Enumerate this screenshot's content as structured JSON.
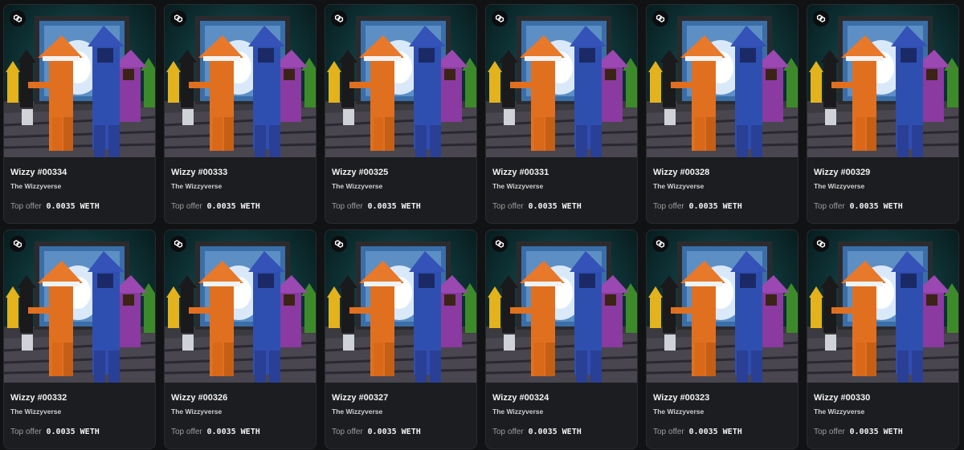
{
  "offer_label": "Top offer",
  "chain_icon": "polygon-chain-icon",
  "colors": {
    "background": "#111214",
    "card": "#1c1d20",
    "text": "#f2f2f2",
    "muted": "#9c9c9c"
  },
  "items": [
    {
      "name": "Wizzy #00334",
      "collection": "The Wizzyverse",
      "price": "0.0035 WETH"
    },
    {
      "name": "Wizzy #00333",
      "collection": "The Wizzyverse",
      "price": "0.0035 WETH"
    },
    {
      "name": "Wizzy #00325",
      "collection": "The Wizzyverse",
      "price": "0.0035 WETH"
    },
    {
      "name": "Wizzy #00331",
      "collection": "The Wizzyverse",
      "price": "0.0035 WETH"
    },
    {
      "name": "Wizzy #00328",
      "collection": "The Wizzyverse",
      "price": "0.0035 WETH"
    },
    {
      "name": "Wizzy #00329",
      "collection": "The Wizzyverse",
      "price": "0.0035 WETH"
    },
    {
      "name": "Wizzy #00332",
      "collection": "The Wizzyverse",
      "price": "0.0035 WETH"
    },
    {
      "name": "Wizzy #00326",
      "collection": "The Wizzyverse",
      "price": "0.0035 WETH"
    },
    {
      "name": "Wizzy #00327",
      "collection": "The Wizzyverse",
      "price": "0.0035 WETH"
    },
    {
      "name": "Wizzy #00324",
      "collection": "The Wizzyverse",
      "price": "0.0035 WETH"
    },
    {
      "name": "Wizzy #00323",
      "collection": "The Wizzyverse",
      "price": "0.0035 WETH"
    },
    {
      "name": "Wizzy #00330",
      "collection": "The Wizzyverse",
      "price": "0.0035 WETH"
    }
  ]
}
